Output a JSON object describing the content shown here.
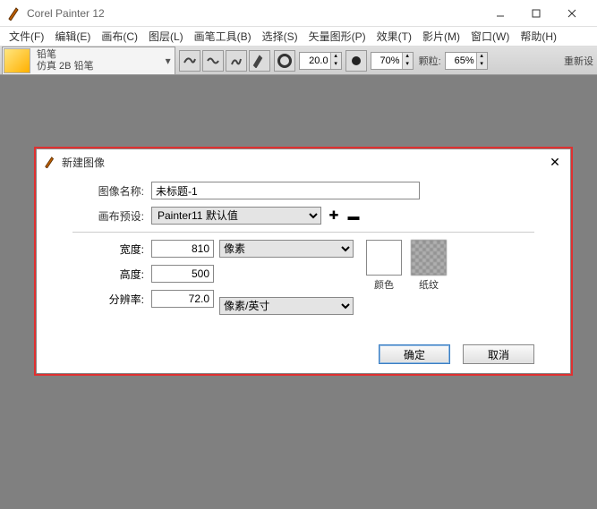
{
  "app": {
    "title": "Corel Painter 12"
  },
  "menu": {
    "file": "文件(F)",
    "edit": "编辑(E)",
    "canvas": "画布(C)",
    "layer": "图层(L)",
    "brush": "画笔工具(B)",
    "select": "选择(S)",
    "vector": "矢量图形(P)",
    "effect": "效果(T)",
    "movie": "影片(M)",
    "window": "窗口(W)",
    "help": "帮助(H)"
  },
  "brush": {
    "category": "铅笔",
    "variant": "仿真 2B 铅笔"
  },
  "prop": {
    "size": "20.0",
    "opacity": "70%",
    "grain_label": "颗粒:",
    "grain": "65%",
    "reset": "重新设"
  },
  "dialog": {
    "title": "新建图像",
    "name_label": "图像名称:",
    "name_value": "未标题-1",
    "preset_label": "画布预设:",
    "preset_value": "Painter11 默认值",
    "width_label": "宽度:",
    "width_value": "810",
    "height_label": "高度:",
    "height_value": "500",
    "res_label": "分辨率:",
    "res_value": "72.0",
    "unit_dim": "像素",
    "unit_res": "像素/英寸",
    "color_label": "颜色",
    "texture_label": "纸纹",
    "ok": "确定",
    "cancel": "取消"
  }
}
